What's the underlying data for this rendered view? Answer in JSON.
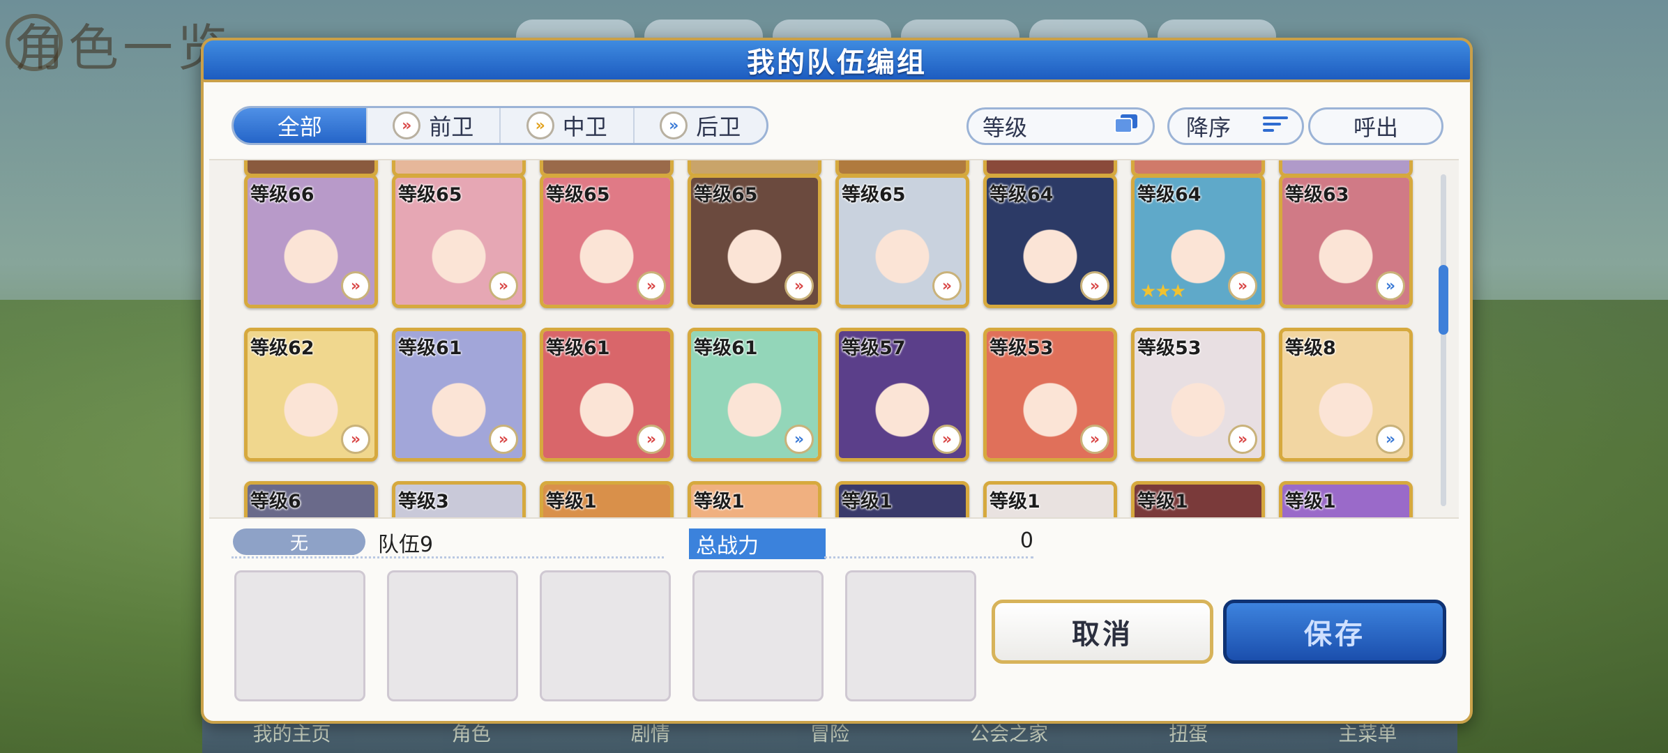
{
  "background": {
    "screen_title": "角色一览",
    "bottom_nav": [
      "我的主页",
      "角色",
      "剧情",
      "冒险",
      "公会之家",
      "扭蛋",
      "主菜单"
    ]
  },
  "dialog": {
    "title": "我的队伍编组",
    "filter_tabs": [
      {
        "label": "全部",
        "active": true,
        "icon": ""
      },
      {
        "label": "前卫",
        "active": false,
        "icon": "vanguard-chevron-icon"
      },
      {
        "label": "中卫",
        "active": false,
        "icon": "midguard-chevron-icon"
      },
      {
        "label": "后卫",
        "active": false,
        "icon": "rearguard-chevron-icon"
      }
    ],
    "sort_field": "等级",
    "sort_order": "降序",
    "call_button": "呼出",
    "characters": [
      {
        "level": "等级66",
        "role": "front",
        "bg": "#b89ac9",
        "stars": 0
      },
      {
        "level": "等级65",
        "role": "front",
        "bg": "#e6a7b4",
        "stars": 0
      },
      {
        "level": "等级65",
        "role": "front",
        "bg": "#e07a86",
        "stars": 0
      },
      {
        "level": "等级65",
        "role": "front",
        "bg": "#6b4a3e",
        "stars": 0
      },
      {
        "level": "等级65",
        "role": "front",
        "bg": "#c9d2de",
        "stars": 0
      },
      {
        "level": "等级64",
        "role": "front",
        "bg": "#2c3a66",
        "stars": 0
      },
      {
        "level": "等级64",
        "role": "front",
        "bg": "#5fa9c9",
        "stars": 3
      },
      {
        "level": "等级63",
        "role": "rear",
        "bg": "#d07a86",
        "stars": 0
      },
      {
        "level": "等级62",
        "role": "front",
        "bg": "#f0d78e",
        "stars": 0
      },
      {
        "level": "等级61",
        "role": "front",
        "bg": "#a2a6d9",
        "stars": 0
      },
      {
        "level": "等级61",
        "role": "front",
        "bg": "#d9666a",
        "stars": 0
      },
      {
        "level": "等级61",
        "role": "rear",
        "bg": "#93d6b9",
        "stars": 0
      },
      {
        "level": "等级57",
        "role": "front",
        "bg": "#5b3f8a",
        "stars": 0
      },
      {
        "level": "等级53",
        "role": "front",
        "bg": "#e0705a",
        "stars": 0
      },
      {
        "level": "等级53",
        "role": "front",
        "bg": "#e8dfe2",
        "stars": 0
      },
      {
        "level": "等级8",
        "role": "rear",
        "bg": "#f2d6a2",
        "stars": 0
      }
    ],
    "partial_bottom_levels": [
      "等级6",
      "等级3",
      "等级1",
      "等级1",
      "等级1",
      "等级1",
      "等级1",
      "等级1"
    ],
    "team_tag": "无",
    "team_name": "队伍9",
    "power_label": "总战力",
    "power_value": "0",
    "cancel_button": "取消",
    "save_button": "保存",
    "colors": {
      "primary": "#2a6fd2",
      "gold": "#d6a93e",
      "front_icon": "#d94848",
      "mid_icon": "#e2a21e",
      "rear_icon": "#3b7ad6"
    }
  }
}
